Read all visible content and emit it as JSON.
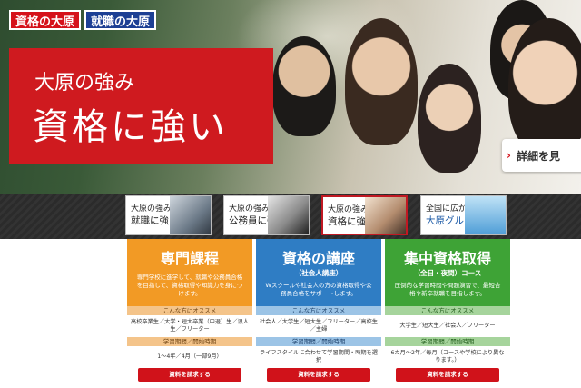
{
  "header": {
    "logo_shikaku": "資格の大原",
    "logo_shushoku": "就職の大原",
    "sub_heading": "大原の強み",
    "main_heading": "資格に強い",
    "detail_button": "詳細を見"
  },
  "tabs": [
    {
      "line1": "大原の強み",
      "line2": "就職に強い",
      "active": false
    },
    {
      "line1": "大原の強み",
      "line2": "公務員に強い",
      "active": false
    },
    {
      "line1": "大原の強み",
      "line2": "資格に強い",
      "active": true
    },
    {
      "line1": "全国に広がる",
      "line2": "大原グループ",
      "active": false
    }
  ],
  "columns": [
    {
      "title": "専門課程",
      "subtitle": "",
      "desc": "専門学校に進学して、就職や公務員合格を目指して、資格取得や知識力を身につけます。",
      "recommend_label": "こんな方にオススメ",
      "recommend": "高校卒業生／大学・短大卒業（中退）生／浪人生／フリーター",
      "period_label": "学習期間／開始時期",
      "period": "1～4年／4月（一部9月）",
      "request": "資料を請求する"
    },
    {
      "title": "資格の講座",
      "subtitle": "（社会人講座）",
      "desc": "Wスクールや社会人の方の資格取得や公務員合格をサポートします。",
      "recommend_label": "こんな方にオススメ",
      "recommend": "社会人／大学生／短大生／フリーター／高校生／主婦",
      "period_label": "学習期間／開始時期",
      "period": "ライフスタイルに合わせて学習期間・時期を選択",
      "request": "資料を請求する"
    },
    {
      "title": "集中資格取得",
      "subtitle": "（全日・夜間）コース",
      "desc": "圧倒的な学習時間や問題演習で、最短合格や新卒就職を目指します。",
      "recommend_label": "こんな方にオススメ",
      "recommend": "大学生／短大生／社会人／フリーター",
      "period_label": "学習期間／開始時期",
      "period": "6カ月～2年／毎月（コースや学校により異なります。）",
      "request": "資料を請求する"
    }
  ]
}
